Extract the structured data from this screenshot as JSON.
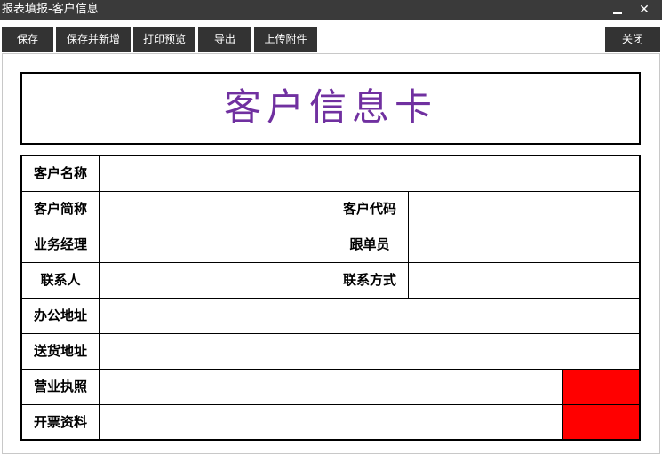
{
  "window": {
    "title": "报表填报-客户信息",
    "min_icon": "minimize-icon",
    "close_icon": "close-icon",
    "close_glyph": "✕"
  },
  "toolbar": {
    "save": "保存",
    "save_new": "保存并新增",
    "print_preview": "打印预览",
    "export": "导出",
    "upload": "上传附件",
    "close": "关闭"
  },
  "card": {
    "title": "客户信息卡",
    "title_color": "#7030a0"
  },
  "form": {
    "customer_name": "客户名称",
    "customer_short": "客户简称",
    "customer_code": "客户代码",
    "business_manager": "业务经理",
    "follower": "跟单员",
    "contact": "联系人",
    "contact_method": "联系方式",
    "office_address": "办公地址",
    "delivery_address": "送货地址",
    "business_license": "营业执照",
    "invoice_info": "开票资料",
    "attachment_color": "#ff0000"
  }
}
